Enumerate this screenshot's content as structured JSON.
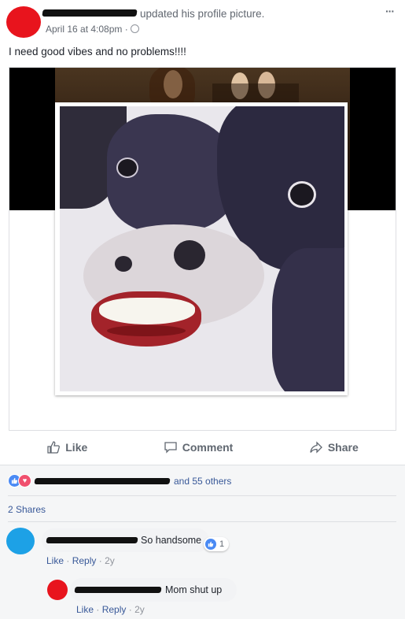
{
  "post": {
    "header_text": "updated his profile picture.",
    "date": "April 16 at 4:08pm",
    "separator": "·",
    "menu": "···",
    "body_text": "I need good vibes and no problems!!!!"
  },
  "actions": {
    "like": "Like",
    "comment": "Comment",
    "share": "Share"
  },
  "reactions": {
    "others_text": "and 55 others"
  },
  "shares": {
    "text": "2 Shares"
  },
  "comments": [
    {
      "text": "So handsome",
      "reaction_count": "1",
      "like": "Like",
      "reply": "Reply",
      "age": "2y",
      "dot": "·"
    },
    {
      "text": "Mom shut up",
      "like": "Like",
      "reply": "Reply",
      "age": "2y",
      "dot": "·"
    }
  ],
  "colors": {
    "avatar_poster": "#e8141d",
    "avatar_commenter1": "#1da1e6",
    "avatar_commenter2": "#e8141d",
    "link": "#385898",
    "feed_bg": "#f5f6f7"
  }
}
